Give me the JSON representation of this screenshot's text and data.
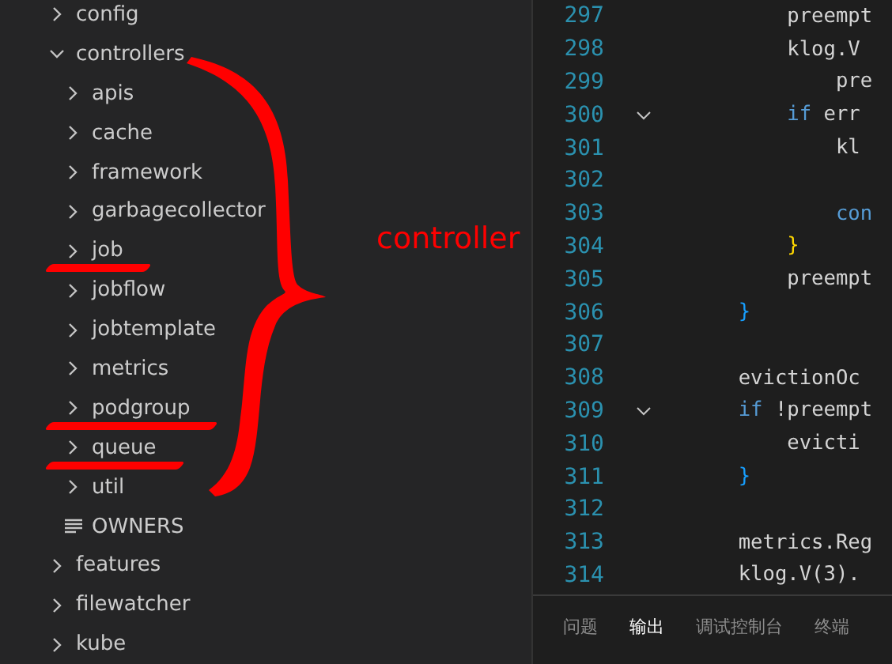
{
  "explorer": {
    "items": [
      {
        "name": "config",
        "kind": "folder",
        "expanded": false,
        "underlined": false
      },
      {
        "name": "controllers",
        "kind": "folder",
        "expanded": true,
        "underlined": false,
        "children": [
          {
            "name": "apis",
            "kind": "folder",
            "expanded": false,
            "underlined": false
          },
          {
            "name": "cache",
            "kind": "folder",
            "expanded": false,
            "underlined": false
          },
          {
            "name": "framework",
            "kind": "folder",
            "expanded": false,
            "underlined": false
          },
          {
            "name": "garbagecollector",
            "kind": "folder",
            "expanded": false,
            "underlined": false
          },
          {
            "name": "job",
            "kind": "folder",
            "expanded": false,
            "underlined": true
          },
          {
            "name": "jobflow",
            "kind": "folder",
            "expanded": false,
            "underlined": false
          },
          {
            "name": "jobtemplate",
            "kind": "folder",
            "expanded": false,
            "underlined": false
          },
          {
            "name": "metrics",
            "kind": "folder",
            "expanded": false,
            "underlined": false
          },
          {
            "name": "podgroup",
            "kind": "folder",
            "expanded": false,
            "underlined": true
          },
          {
            "name": "queue",
            "kind": "folder",
            "expanded": false,
            "underlined": true
          },
          {
            "name": "util",
            "kind": "folder",
            "expanded": false,
            "underlined": false
          },
          {
            "name": "OWNERS",
            "kind": "file",
            "underlined": false
          }
        ]
      },
      {
        "name": "features",
        "kind": "folder",
        "expanded": false,
        "underlined": false
      },
      {
        "name": "filewatcher",
        "kind": "folder",
        "expanded": false,
        "underlined": false
      },
      {
        "name": "kube",
        "kind": "folder",
        "expanded": false,
        "underlined": false
      }
    ]
  },
  "annotation": {
    "label": "controller"
  },
  "editor": {
    "lines": [
      {
        "number": "297",
        "foldable": false,
        "tokens": [
          {
            "text": "\t\tpreempt",
            "kind": "plain"
          }
        ]
      },
      {
        "number": "298",
        "foldable": false,
        "tokens": [
          {
            "text": "\t\tklog.V",
            "kind": "plain"
          }
        ]
      },
      {
        "number": "299",
        "foldable": false,
        "tokens": [
          {
            "text": "\t\t\tpre",
            "kind": "plain"
          }
        ]
      },
      {
        "number": "300",
        "foldable": true,
        "tokens": [
          {
            "text": "\t\tif",
            "kind": "keyword"
          },
          {
            "text": " err",
            "kind": "plain"
          }
        ]
      },
      {
        "number": "301",
        "foldable": false,
        "tokens": [
          {
            "text": "\t\t\tkl",
            "kind": "plain"
          }
        ]
      },
      {
        "number": "302",
        "foldable": false
      },
      {
        "number": "303",
        "foldable": false,
        "tokens": [
          {
            "text": "\t\t\tcon",
            "kind": "keyword"
          }
        ]
      },
      {
        "number": "304",
        "foldable": false,
        "tokens": [
          {
            "text": "\t\t}",
            "kind": "brace1"
          }
        ]
      },
      {
        "number": "305",
        "foldable": false,
        "tokens": [
          {
            "text": "\t\tpreempt",
            "kind": "plain"
          }
        ]
      },
      {
        "number": "306",
        "foldable": false,
        "tokens": [
          {
            "text": "\t}",
            "kind": "brace2"
          }
        ]
      },
      {
        "number": "307",
        "foldable": false
      },
      {
        "number": "308",
        "foldable": false,
        "tokens": [
          {
            "text": "\tevictionOc",
            "kind": "plain"
          }
        ]
      },
      {
        "number": "309",
        "foldable": true,
        "tokens": [
          {
            "text": "\tif",
            "kind": "keyword"
          },
          {
            "text": " !preempt",
            "kind": "plain"
          }
        ]
      },
      {
        "number": "310",
        "foldable": false,
        "tokens": [
          {
            "text": "\t\tevicti",
            "kind": "plain"
          }
        ]
      },
      {
        "number": "311",
        "foldable": false,
        "tokens": [
          {
            "text": "\t}",
            "kind": "brace2"
          }
        ]
      },
      {
        "number": "312",
        "foldable": false
      },
      {
        "number": "313",
        "foldable": false,
        "tokens": [
          {
            "text": "\tmetrics.Reg",
            "kind": "plain"
          }
        ]
      },
      {
        "number": "314",
        "foldable": false,
        "tokens": [
          {
            "text": "\tklog.V(3).",
            "kind": "plain"
          }
        ]
      }
    ]
  },
  "panel": {
    "tabs": [
      {
        "label": "问题",
        "selected": false
      },
      {
        "label": "输出",
        "selected": true
      },
      {
        "label": "调试控制台",
        "selected": false
      },
      {
        "label": "终端",
        "selected": false
      }
    ]
  }
}
